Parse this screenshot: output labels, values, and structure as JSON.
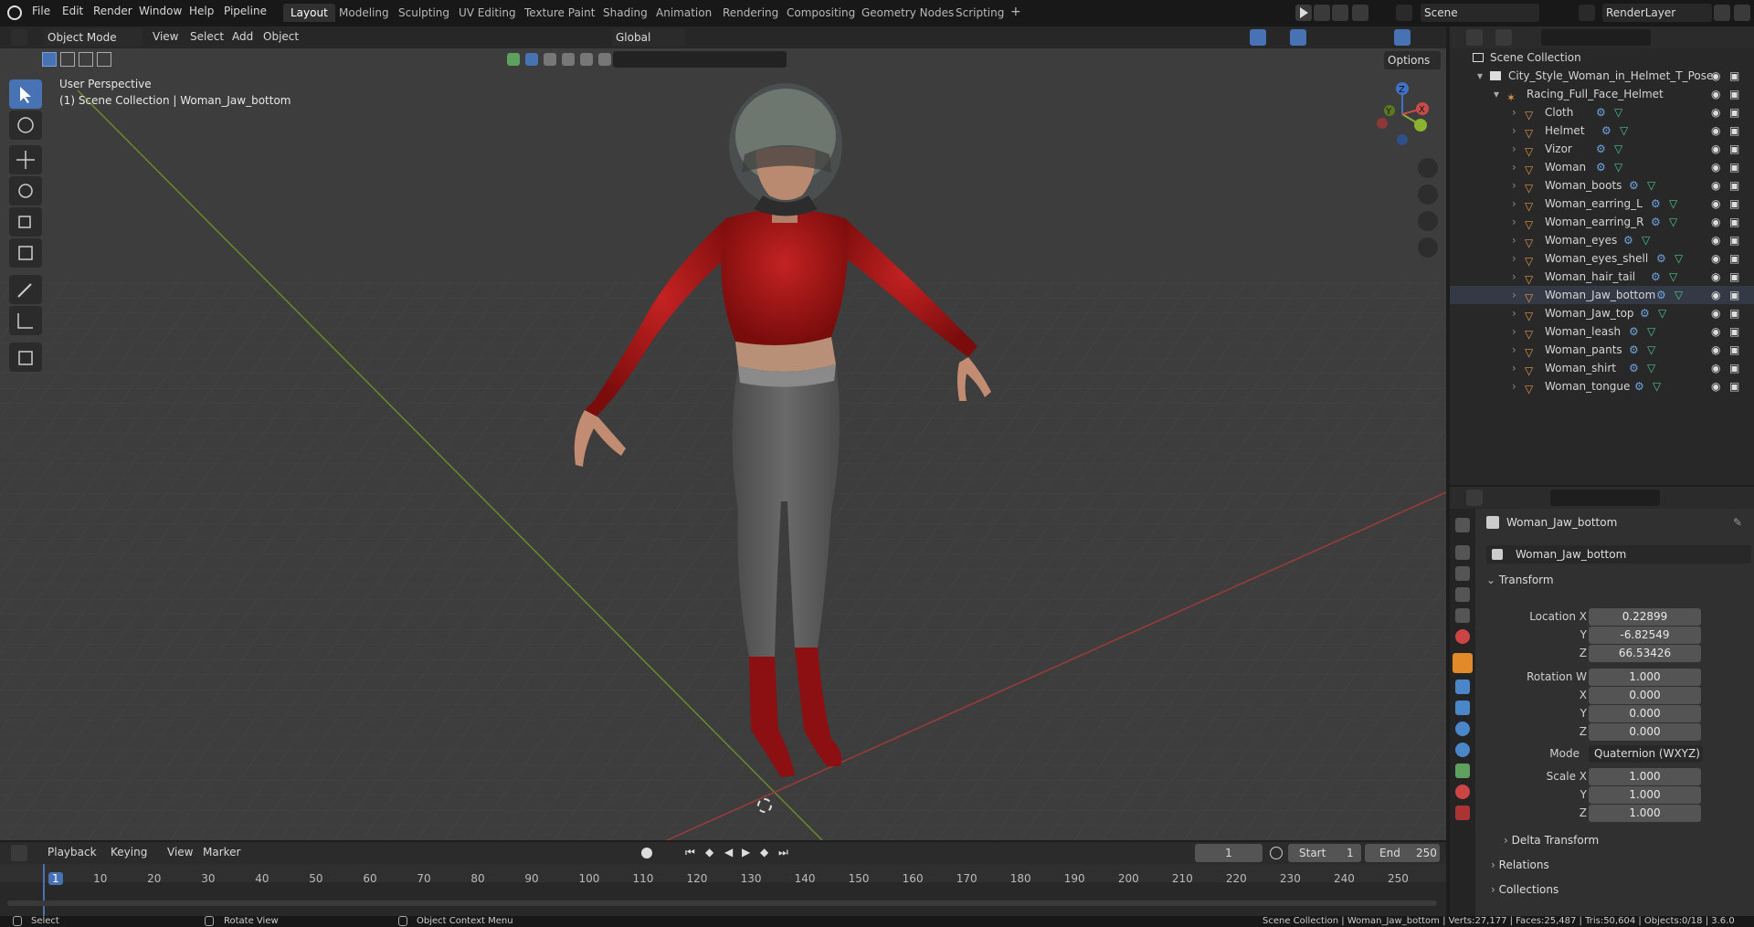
{
  "topbar": {
    "menus": [
      "File",
      "Edit",
      "Render",
      "Window",
      "Help",
      "Pipeline"
    ],
    "workspaces": [
      "Layout",
      "Modeling",
      "Sculpting",
      "UV Editing",
      "Texture Paint",
      "Shading",
      "Animation",
      "Rendering",
      "Compositing",
      "Geometry Nodes",
      "Scripting"
    ],
    "active_workspace": "Layout",
    "add_tab": "+",
    "scene": "Scene",
    "render_layer": "RenderLayer"
  },
  "viewport": {
    "mode": "Object Mode",
    "menus": [
      "View",
      "Select",
      "Add",
      "Object"
    ],
    "orientation": "Global",
    "options": "Options",
    "overlay_title": "User Perspective",
    "overlay_subtitle": "(1) Scene Collection | Woman_Jaw_bottom",
    "gizmo_axes": {
      "z": "Z",
      "y": "Y",
      "x": "X"
    }
  },
  "outliner": {
    "root": "Scene Collection",
    "collection": "City_Style_Woman_in_Helmet_T_Pose",
    "armature": "Racing_Full_Face_Helmet",
    "objects": [
      "Cloth",
      "Helmet",
      "Vizor",
      "Woman",
      "Woman_boots",
      "Woman_earring_L",
      "Woman_earring_R",
      "Woman_eyes",
      "Woman_eyes_shell",
      "Woman_hair_tail",
      "Woman_Jaw_bottom",
      "Woman_Jaw_top",
      "Woman_leash",
      "Woman_pants",
      "Woman_shirt",
      "Woman_tongue"
    ],
    "selected": "Woman_Jaw_bottom"
  },
  "properties": {
    "object_name": "Woman_Jaw_bottom",
    "datablock": "Woman_Jaw_bottom",
    "panel_transform": "Transform",
    "location_label": "Location X",
    "location": {
      "x": "0.22899",
      "y": "-6.82549",
      "z": "66.53426"
    },
    "rotation_label": "Rotation W",
    "rotation": {
      "w": "1.000",
      "x": "0.000",
      "y": "0.000",
      "z": "0.000"
    },
    "mode_label": "Mode",
    "mode": "Quaternion (WXYZ)",
    "scale_label": "Scale X",
    "scale": {
      "x": "1.000",
      "y": "1.000",
      "z": "1.000"
    },
    "axis_y": "Y",
    "axis_z": "Z",
    "axis_x": "X",
    "delta": "Delta Transform",
    "relations": "Relations",
    "collections": "Collections"
  },
  "timeline": {
    "menus": [
      "Playback",
      "Keying",
      "View",
      "Marker"
    ],
    "current_frame": "1",
    "start_label": "Start",
    "start": "1",
    "end_label": "End",
    "end": "250",
    "ruler": [
      "1",
      "10",
      "20",
      "30",
      "40",
      "50",
      "60",
      "70",
      "80",
      "90",
      "100",
      "110",
      "120",
      "130",
      "140",
      "150",
      "160",
      "170",
      "180",
      "190",
      "200",
      "210",
      "220",
      "230",
      "240",
      "250"
    ]
  },
  "statusbar": {
    "select": "Select",
    "rotate": "Rotate View",
    "context": "Object Context Menu",
    "stats": "Scene Collection | Woman_Jaw_bottom | Verts:27,177 | Faces:25,487 | Tris:50,604 | Objects:0/18 | 3.6.0"
  },
  "colors": {
    "accent": "#4772b3",
    "shirt": "#b01818",
    "pants": "#5a5a5a",
    "grid": "#4a4a4a",
    "axis_x": "#a03a3a",
    "axis_y": "#6a8a2a"
  }
}
